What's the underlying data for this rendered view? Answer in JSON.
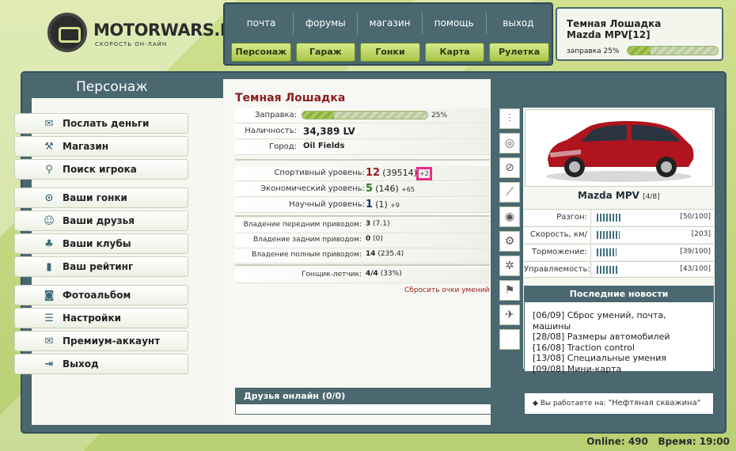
{
  "logo": {
    "text": "MOTORWARS.RU",
    "subtitle": "СКОРОСТЬ ОН-ЛАЙН"
  },
  "topnav": {
    "links": [
      "почта",
      "форумы",
      "магазин",
      "помощь",
      "выход"
    ],
    "buttons": [
      "Персонаж",
      "Гараж",
      "Гонки",
      "Карта",
      "Рулетка"
    ]
  },
  "user": {
    "name": "Темная Лошадка",
    "car": "Mazda MPV[12]",
    "fuel_label": "заправка 25%",
    "fuel_fraction": 0.25
  },
  "left": {
    "title": "Персонаж",
    "menu": [
      {
        "label": "Послать деньги",
        "icon": "money-icon"
      },
      {
        "label": "Магазин",
        "icon": "shop-icon"
      },
      {
        "label": "Поиск игрока",
        "icon": "search-icon"
      },
      {
        "label": "Ваши гонки",
        "icon": "steering-wheel-icon"
      },
      {
        "label": "Ваши друзья",
        "icon": "friends-icon"
      },
      {
        "label": "Ваши клубы",
        "icon": "clubs-icon"
      },
      {
        "label": "Ваш рейтинг",
        "icon": "rating-icon"
      },
      {
        "label": "Фотоальбом",
        "icon": "camera-icon"
      },
      {
        "label": "Настройки",
        "icon": "settings-icon"
      },
      {
        "label": "Премиум-аккаунт",
        "icon": "premium-icon"
      },
      {
        "label": "Выход",
        "icon": "exit-icon"
      }
    ]
  },
  "character": {
    "name": "Темная Лошадка",
    "fuel": {
      "label": "Заправка:",
      "percent_text": "25%",
      "fraction": 0.25
    },
    "cash": {
      "label": "Наличность:",
      "value": "34,389 LV"
    },
    "city": {
      "label": "Город:",
      "value": "Oil Fields"
    },
    "levels": [
      {
        "label": "Спортивный уровень:",
        "level": "12",
        "points": "(39514)",
        "plus": "+2",
        "color": "#9c1a1a"
      },
      {
        "label": "Экономический уровень:",
        "level": "5",
        "points": "(146)",
        "plus": "+65",
        "color": "#2d7a1a"
      },
      {
        "label": "Научный уровень:",
        "level": "1",
        "points": "(1)",
        "plus": "+9",
        "color": "#1a2f7a"
      }
    ],
    "drives": [
      {
        "label": "Владение передним приводом:",
        "value": "3",
        "extra": "(7.1)"
      },
      {
        "label": "Владение задним приводом:",
        "value": "0",
        "extra": "(0)"
      },
      {
        "label": "Владение полным приводом:",
        "value": "14",
        "extra": "(235.4)"
      }
    ],
    "pilot": {
      "label": "Гонщик-летчик:",
      "value": "4/4",
      "extra": "(33%)"
    },
    "reset_link": "Сбросить очки умений"
  },
  "friends": {
    "title": "Друзья онлайн (0/0)"
  },
  "car": {
    "name": "Mazda MPV",
    "count": "[4/8]",
    "stats": [
      {
        "label": "Разгон:",
        "value": "[50/100]",
        "fraction": 0.5
      },
      {
        "label": "Скорость, км/ч:",
        "value": "[203]",
        "fraction": 0.45
      },
      {
        "label": "Торможение:",
        "value": "[39/100]",
        "fraction": 0.39
      },
      {
        "label": "Управляемость:",
        "value": "[43/100]",
        "fraction": 0.43
      }
    ]
  },
  "news": {
    "title": "Последние новости",
    "items": [
      "[06/09] Сброс умений, почта, машины",
      "[28/08] Размеры автомобилей",
      "[16/08] Traction control",
      "[13/08] Специальные умения",
      "[09/08] Мини-карта"
    ]
  },
  "work": {
    "prefix": "Вы работаете на:",
    "place": "\"Нефтяная скважина\""
  },
  "footer": {
    "online": "Online: 490",
    "time": "Время: 19:00"
  },
  "tools": [
    "shock-absorber-icon",
    "tire-icon",
    "exhaust-icon",
    "spring-icon",
    "brake-disc-icon",
    "engine-icon",
    "gear-icon",
    "seat-icon",
    "turbo-icon",
    "empty-slot"
  ]
}
